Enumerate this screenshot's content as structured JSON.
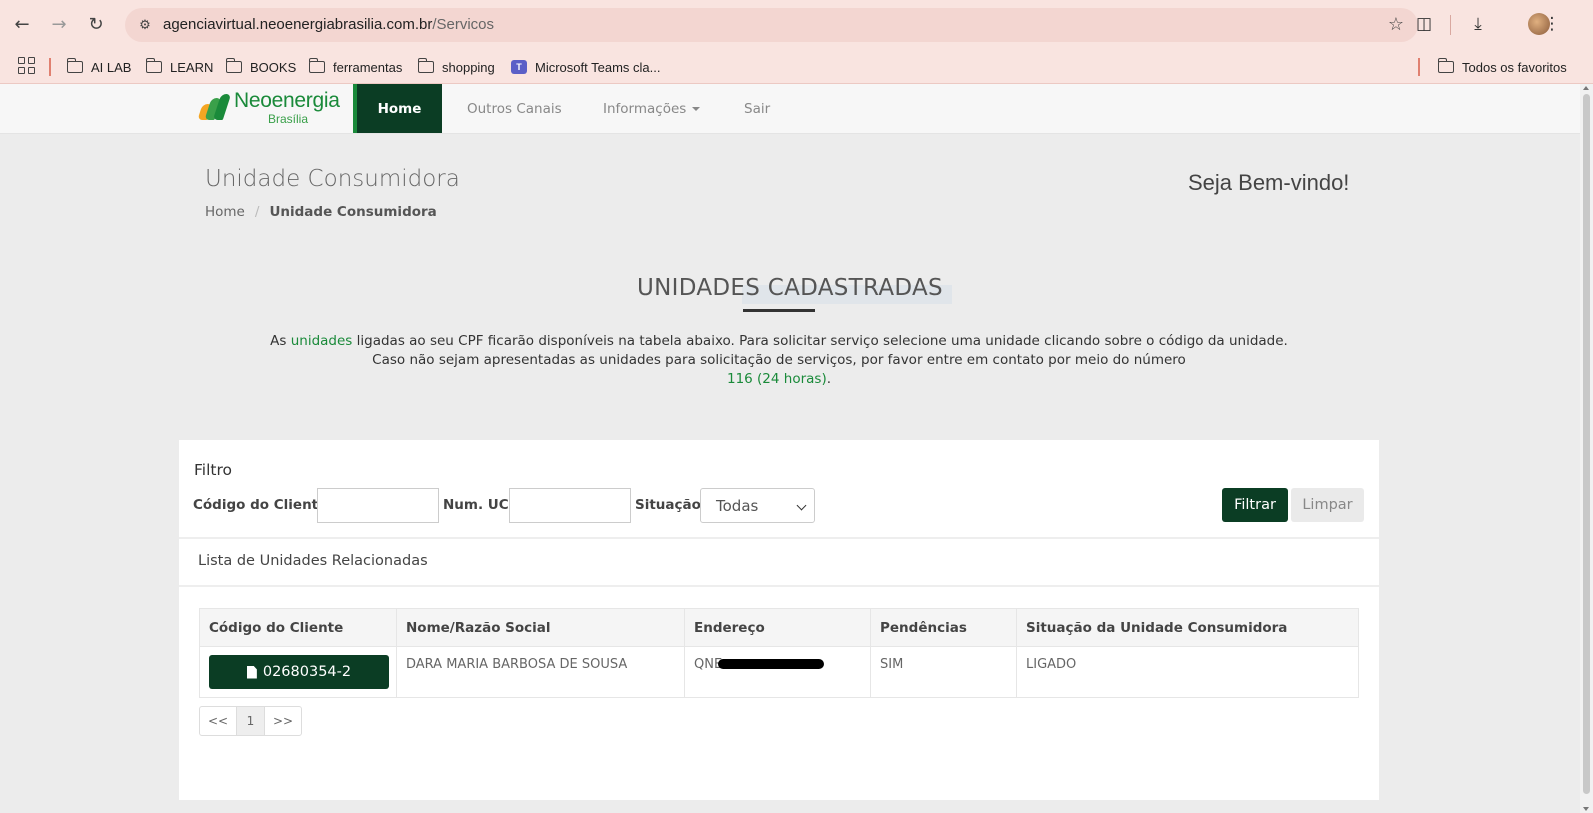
{
  "browser": {
    "url_domain": "agenciavirtual.neoenergiabrasilia.com.br",
    "url_path": "/Servicos",
    "bookmarks": [
      "AI LAB",
      "LEARN",
      "BOOKS",
      "ferramentas",
      "shopping",
      "Microsoft Teams cla..."
    ],
    "all_bookmarks": "Todos os favoritos"
  },
  "site": {
    "logo_brand": "Neoenergia",
    "logo_sub": "Brasília",
    "nav": {
      "home": "Home",
      "outros": "Outros Canais",
      "informacoes": "Informações",
      "sair": "Sair"
    }
  },
  "page": {
    "title": "Unidade Consumidora",
    "breadcrumb_home": "Home",
    "breadcrumb_current": "Unidade Consumidora",
    "welcome": "Seja Bem-vindo!",
    "section_title": "UNIDADES CADASTRADAS",
    "info_line1_pre": "As ",
    "info_line1_hl": "unidades",
    "info_line1_post": " ligadas ao seu CPF ficarão disponíveis na tabela abaixo. Para solicitar serviço selecione uma unidade clicando sobre o código da unidade.",
    "info_line2": "Caso não sejam apresentadas as unidades para solicitação de serviços, por favor entre em contato por meio do número",
    "info_phone": "116 (24 horas)",
    "info_phone_end": "."
  },
  "filter": {
    "title": "Filtro",
    "codigo_label": "Código do Cliente:",
    "codigo_value": "",
    "uc_label": "Num. UC:",
    "uc_value": "",
    "situacao_label": "Situação:",
    "situacao_selected": "Todas",
    "filtrar": "Filtrar",
    "limpar": "Limpar"
  },
  "list": {
    "title": "Lista de Unidades Relacionadas",
    "columns": [
      "Código do Cliente",
      "Nome/Razão Social",
      "Endereço",
      "Pendências",
      "Situação da Unidade Consumidora"
    ],
    "rows": [
      {
        "codigo": "02680354-2",
        "nome": "DARA MARIA BARBOSA DE SOUSA",
        "endereco": "QNE",
        "pendencias": "SIM",
        "situacao": "LIGADO"
      }
    ]
  },
  "pagination": {
    "prev": "<<",
    "page": "1",
    "next": ">>"
  },
  "colors": {
    "brand_dark": "#0b3d24",
    "brand_green": "#1a8a3a"
  },
  "icons": [
    "back-arrow-icon",
    "forward-arrow-icon",
    "reload-icon",
    "site-settings-icon",
    "star-icon",
    "extensions-icon",
    "download-icon",
    "menu-dots-icon",
    "apps-grid-icon",
    "folder-icon",
    "teams-icon",
    "document-icon",
    "chevron-down-icon"
  ]
}
